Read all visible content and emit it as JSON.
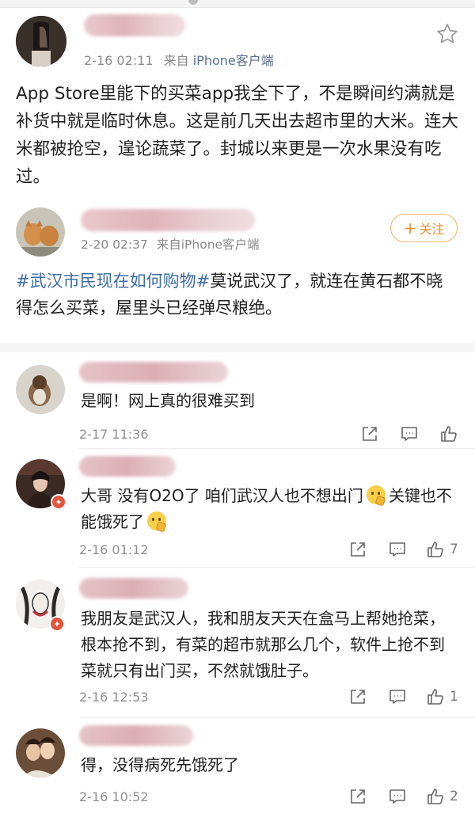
{
  "post1": {
    "time": "2-16 02:11",
    "source_prefix": "来自",
    "source": "iPhone客户端",
    "body": "App Store里能下的买菜app我全下了，不是瞬间约满就是补货中就是临时休息。这是前几天出去超市里的大米。连大米都被抢空，遑论蔬菜了。封城以来更是一次水果没有吃过。"
  },
  "post2": {
    "time": "2-20 02:37",
    "source_prefix": "来自",
    "source": "iPhone客户端",
    "follow_label": "关注",
    "topic": "#武汉市民现在如何购物#",
    "body": "莫说武汉了，就连在黄石都不晓得怎么买菜，屋里头已经弹尽粮绝。"
  },
  "comments": [
    {
      "text": "是啊！网上真的很难买到",
      "time": "2-17 11:36",
      "likes": ""
    },
    {
      "text_a": "大哥 没有O2O了 咱们武汉人也不想出门",
      "text_b": "关键也不能饿死了",
      "time": "2-16 01:12",
      "likes": "7"
    },
    {
      "text": "我朋友是武汉人，我和朋友天天在盒马上帮她抢菜，根本抢不到，有菜的超市就那么几个，软件上抢不到菜就只有出门买，不然就饿肚子。",
      "time": "2-16 12:53",
      "likes": "1"
    },
    {
      "text": "得，没得病死先饿死了",
      "time": "2-16 10:52",
      "likes": "2"
    }
  ],
  "icons": {
    "star": "star-icon",
    "share": "share-icon",
    "comment": "comment-icon",
    "like": "thumbs-up-icon",
    "emoji": "thinking-emoji"
  },
  "colors": {
    "link": "#3c6ea6",
    "follow": "#e8912f",
    "meta": "#8a8a8a"
  }
}
